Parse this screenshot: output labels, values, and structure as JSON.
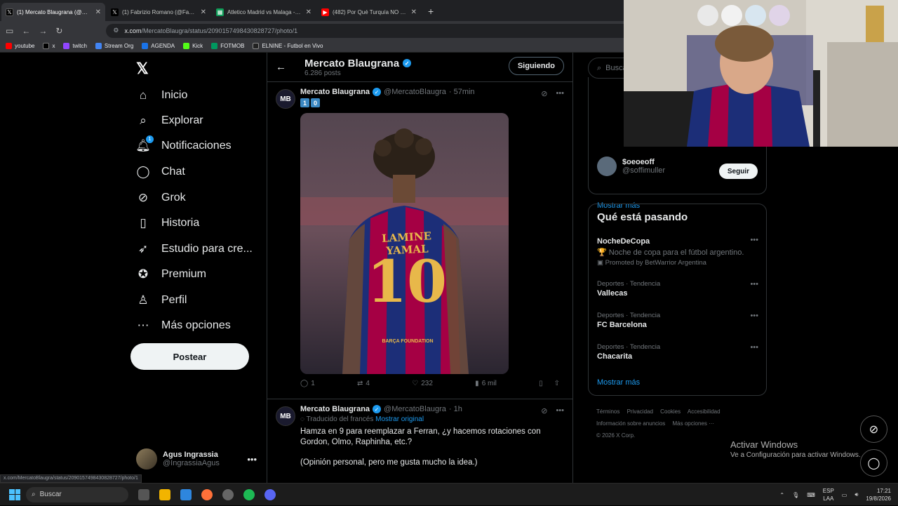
{
  "browser": {
    "tabs": [
      {
        "title": "(1) Mercato Blaugrana (@Mercat",
        "active": true
      },
      {
        "title": "(1) Fabrizio Romano (@Fabrizio",
        "active": false
      },
      {
        "title": "Atletico Madrid vs Malaga - ma",
        "active": false
      },
      {
        "title": "(482) Por Qué Turquía NO DEBE",
        "active": false
      }
    ],
    "url_domain": "x.com",
    "url_path": "/MercatoBlaugra/status/2090157498430828727/photo/1",
    "bookmarks": [
      "youtube",
      "x",
      "twitch",
      "Stream Org",
      "AGENDA",
      "Kick",
      "FOTMOB",
      "ELNINE - Futbol en Vivo"
    ]
  },
  "nav": {
    "items": [
      "Inicio",
      "Explorar",
      "Notificaciones",
      "Chat",
      "Grok",
      "Historia",
      "Estudio para cre...",
      "Premium",
      "Perfil",
      "Más opciones"
    ],
    "notif_count": "1",
    "post_button": "Postear",
    "account_name": "Agus Ingrassia",
    "account_handle": "@IngrassiaAgus"
  },
  "main": {
    "title": "Mercato Blaugrana",
    "posts": "6.286 posts",
    "follow_label": "Siguiendo",
    "tweets": [
      {
        "name": "Mercato Blaugrana",
        "handle": "@MercatoBlaugra",
        "time": "· 57min",
        "keycaps": [
          "1",
          "0"
        ],
        "photo_text": {
          "name": "LAMINE YAMAL",
          "number": "10",
          "sponsor": "BARÇA FOUNDATION"
        },
        "replies": "1",
        "reposts": "4",
        "likes": "232",
        "views": "6 mil"
      },
      {
        "name": "Mercato Blaugrana",
        "handle": "@MercatoBlaugra",
        "time": "· 1h",
        "translated": "Traducido del francés",
        "show_original": "Mostrar original",
        "text1": "Hamza en 9 para reemplazar a Ferran, ¿y hacemos rotaciones con Gordon, Olmo, Raphinha, etc.?",
        "text2": "(Opinión personal, pero me gusta mucho la idea.)"
      }
    ]
  },
  "right": {
    "search_placeholder": "Buscar",
    "who": {
      "follow_name": "$oeoeoff",
      "follow_handle": "@soffimuller",
      "follow_btn": "Seguir",
      "more": "Mostrar más"
    },
    "trends_title": "Qué está pasando",
    "trends": [
      {
        "category": "",
        "name": "NocheDeCopa",
        "desc": "🏆 Noche de copa para el fútbol argentino.",
        "promo": "Promoted by BetWarrior Argentina"
      },
      {
        "category": "Deportes · Tendencia",
        "name": "Vallecas"
      },
      {
        "category": "Deportes · Tendencia",
        "name": "FC Barcelona"
      },
      {
        "category": "Deportes · Tendencia",
        "name": "Chacarita"
      }
    ],
    "trends_more": "Mostrar más",
    "footer": [
      "Términos",
      "Privacidad",
      "Cookies",
      "Accesibilidad",
      "Información sobre anuncios",
      "Más opciones ···",
      "© 2026 X Corp."
    ]
  },
  "windows": {
    "activate_title": "Activar Windows",
    "activate_sub": "Ve a Configuración para activar Windows.",
    "taskbar_search": "Buscar",
    "lang1": "ESP",
    "lang2": "LAA",
    "time": "17:21",
    "date": "19/8/2026",
    "status_hint": "x.com/MercatoBlaugra/status/2090157498430828727/photo/1"
  },
  "colors": {
    "accent": "#1d9bf0",
    "background": "#000000",
    "border": "#2f3336"
  }
}
